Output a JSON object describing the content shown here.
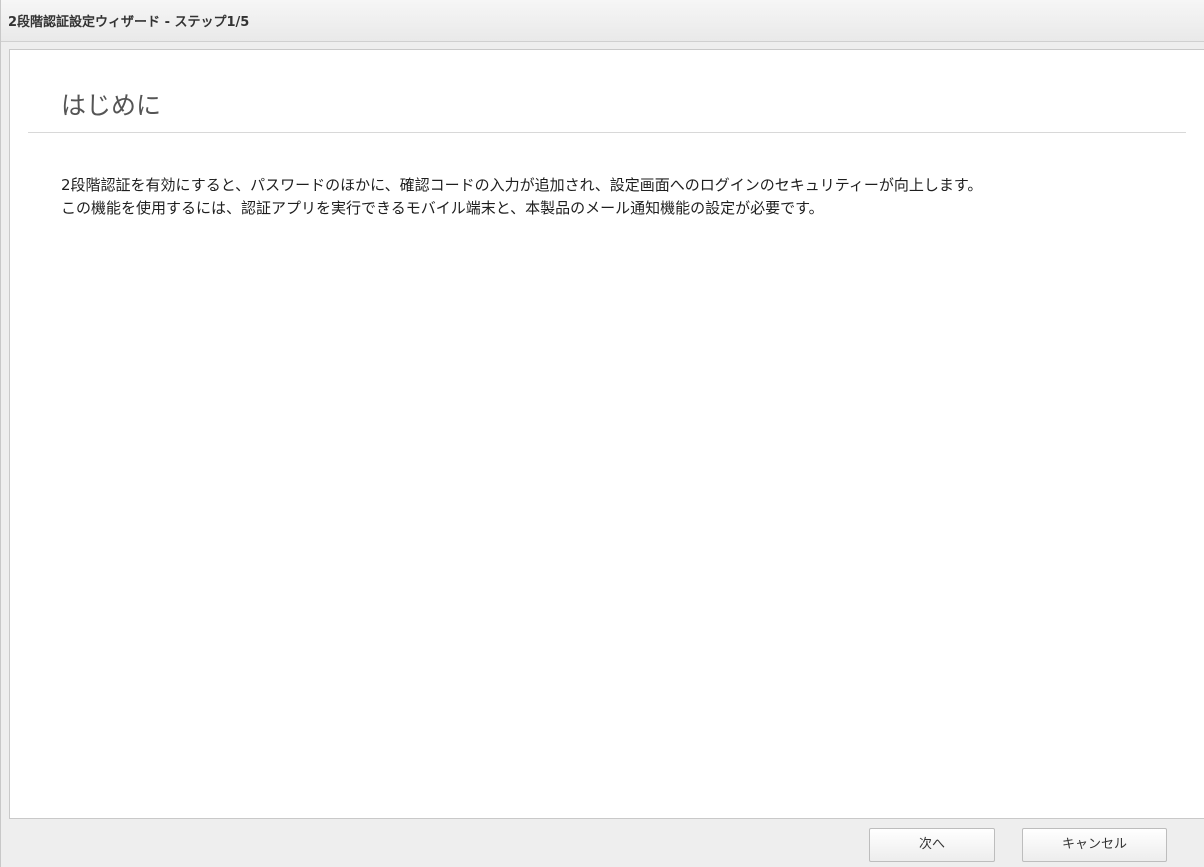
{
  "window": {
    "title": "2段階認証設定ウィザード - ステップ1/5"
  },
  "main": {
    "heading": "はじめに",
    "paragraphs": [
      "2段階認証を有効にすると、パスワードのほかに、確認コードの入力が追加され、設定画面へのログインのセキュリティーが向上します。",
      "この機能を使用するには、認証アプリを実行できるモバイル端末と、本製品のメール通知機能の設定が必要です。"
    ]
  },
  "footer": {
    "next_label": "次へ",
    "cancel_label": "キャンセル"
  }
}
